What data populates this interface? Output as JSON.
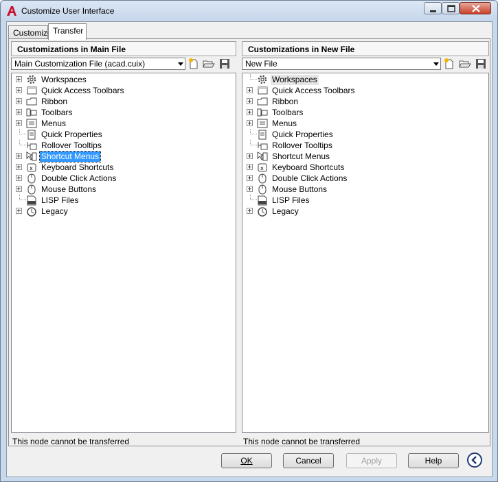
{
  "window": {
    "title": "Customize User Interface"
  },
  "tabs": [
    {
      "label": "Customize",
      "active": false
    },
    {
      "label": "Transfer",
      "active": true
    }
  ],
  "left_pane": {
    "header": "Customizations in Main File",
    "combo_value": "Main Customization File (acad.cuix)",
    "status": "This node cannot be transferred",
    "tree": [
      {
        "label": "Workspaces",
        "icon": "workspaces-icon",
        "expandable": true
      },
      {
        "label": "Quick Access Toolbars",
        "icon": "quick-access-toolbars-icon",
        "expandable": true
      },
      {
        "label": "Ribbon",
        "icon": "ribbon-icon",
        "expandable": true
      },
      {
        "label": "Toolbars",
        "icon": "toolbars-icon",
        "expandable": true
      },
      {
        "label": "Menus",
        "icon": "menus-icon",
        "expandable": true
      },
      {
        "label": "Quick Properties",
        "icon": "quick-properties-icon",
        "expandable": false
      },
      {
        "label": "Rollover Tooltips",
        "icon": "rollover-tooltips-icon",
        "expandable": false
      },
      {
        "label": "Shortcut Menus",
        "icon": "shortcut-menus-icon",
        "expandable": true,
        "selected": true
      },
      {
        "label": "Keyboard Shortcuts",
        "icon": "keyboard-shortcuts-icon",
        "expandable": true
      },
      {
        "label": "Double Click Actions",
        "icon": "double-click-actions-icon",
        "expandable": true
      },
      {
        "label": "Mouse Buttons",
        "icon": "mouse-buttons-icon",
        "expandable": true
      },
      {
        "label": "LISP Files",
        "icon": "lisp-files-icon",
        "expandable": false
      },
      {
        "label": "Legacy",
        "icon": "legacy-icon",
        "expandable": true
      }
    ]
  },
  "right_pane": {
    "header": "Customizations in New File",
    "combo_value": "New File",
    "status": "This node cannot be transferred",
    "tree": [
      {
        "label": "Workspaces",
        "icon": "workspaces-icon",
        "expandable": false,
        "hover": true
      },
      {
        "label": "Quick Access Toolbars",
        "icon": "quick-access-toolbars-icon",
        "expandable": true
      },
      {
        "label": "Ribbon",
        "icon": "ribbon-icon",
        "expandable": true
      },
      {
        "label": "Toolbars",
        "icon": "toolbars-icon",
        "expandable": true
      },
      {
        "label": "Menus",
        "icon": "menus-icon",
        "expandable": true
      },
      {
        "label": "Quick Properties",
        "icon": "quick-properties-icon",
        "expandable": false
      },
      {
        "label": "Rollover Tooltips",
        "icon": "rollover-tooltips-icon",
        "expandable": false
      },
      {
        "label": "Shortcut Menus",
        "icon": "shortcut-menus-icon",
        "expandable": true
      },
      {
        "label": "Keyboard Shortcuts",
        "icon": "keyboard-shortcuts-icon",
        "expandable": true
      },
      {
        "label": "Double Click Actions",
        "icon": "double-click-actions-icon",
        "expandable": true
      },
      {
        "label": "Mouse Buttons",
        "icon": "mouse-buttons-icon",
        "expandable": true
      },
      {
        "label": "LISP Files",
        "icon": "lisp-files-icon",
        "expandable": false
      },
      {
        "label": "Legacy",
        "icon": "legacy-icon",
        "expandable": true
      }
    ]
  },
  "buttons": {
    "ok": "OK",
    "cancel": "Cancel",
    "apply": "Apply",
    "help": "Help"
  },
  "colors": {
    "selection": "#3399ff",
    "title_bar": "#c9d9ec",
    "close_button": "#c9402b"
  }
}
